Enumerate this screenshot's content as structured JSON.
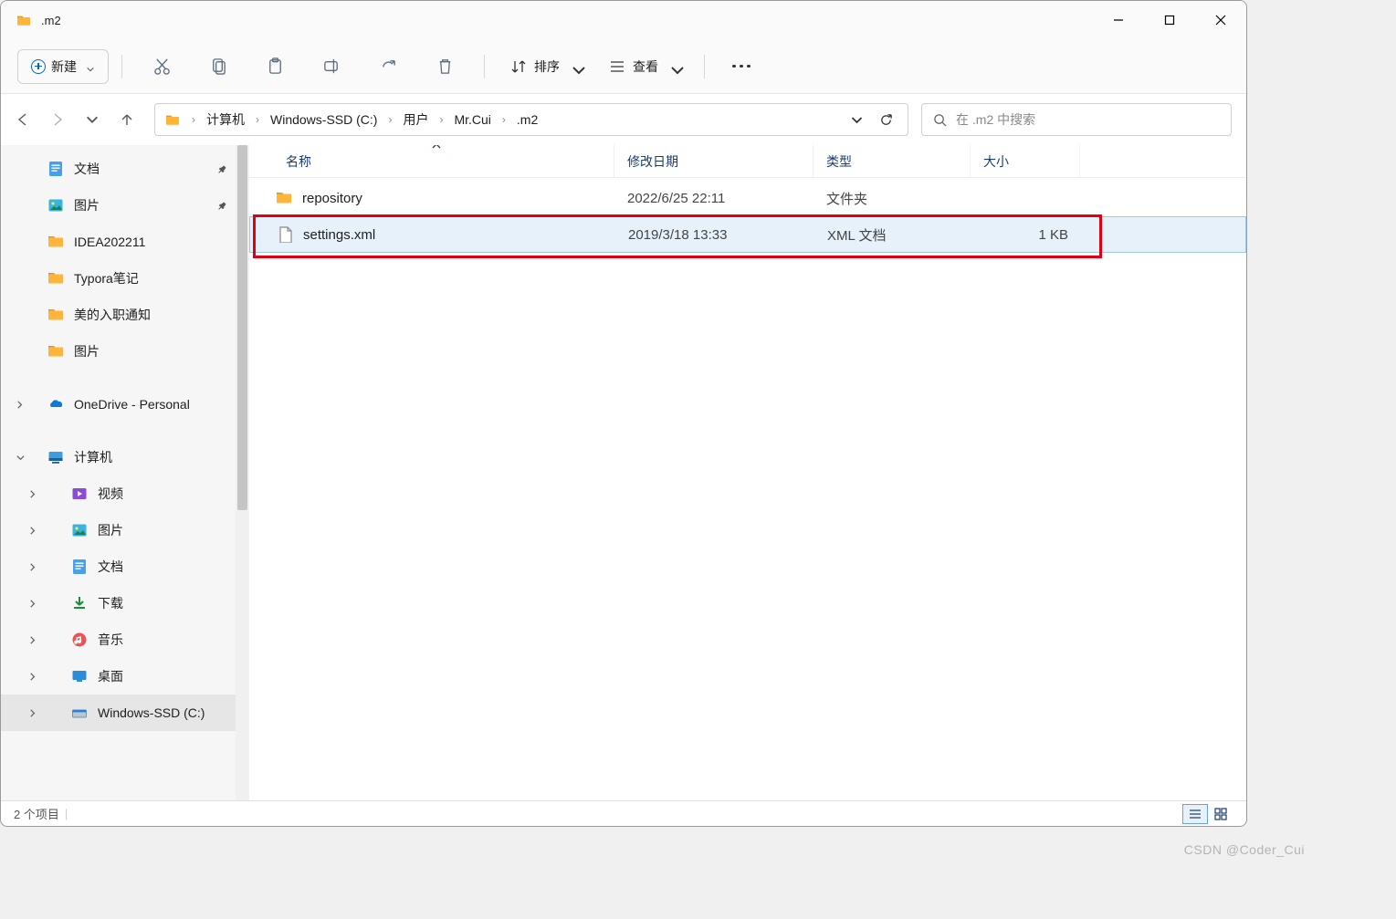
{
  "title": ".m2",
  "toolbar": {
    "new_label": "新建",
    "sort_label": "排序",
    "view_label": "查看"
  },
  "breadcrumbs": [
    "计算机",
    "Windows-SSD (C:)",
    "用户",
    "Mr.Cui",
    ".m2"
  ],
  "search_placeholder": "在 .m2 中搜索",
  "columns": {
    "name": "名称",
    "date": "修改日期",
    "type": "类型",
    "size": "大小"
  },
  "files": [
    {
      "icon": "folder",
      "name": "repository",
      "date": "2022/6/25 22:11",
      "type": "文件夹",
      "size": "",
      "highlight": false
    },
    {
      "icon": "file",
      "name": "settings.xml",
      "date": "2019/3/18 13:33",
      "type": "XML 文档",
      "size": "1 KB",
      "highlight": true
    }
  ],
  "sidebar": {
    "quick": [
      {
        "icon": "doc",
        "label": "文档",
        "pin": true
      },
      {
        "icon": "img",
        "label": "图片",
        "pin": true
      },
      {
        "icon": "folder",
        "label": "IDEA202211",
        "pin": false
      },
      {
        "icon": "folder",
        "label": "Typora笔记",
        "pin": false
      },
      {
        "icon": "folder",
        "label": "美的入职通知",
        "pin": false
      },
      {
        "icon": "folder",
        "label": "图片",
        "pin": false
      }
    ],
    "onedrive": "OneDrive - Personal",
    "computer": "计算机",
    "computer_items": [
      {
        "icon": "video",
        "label": "视频"
      },
      {
        "icon": "img",
        "label": "图片"
      },
      {
        "icon": "doc",
        "label": "文档"
      },
      {
        "icon": "down",
        "label": "下载"
      },
      {
        "icon": "music",
        "label": "音乐"
      },
      {
        "icon": "desk",
        "label": "桌面"
      },
      {
        "icon": "drive",
        "label": "Windows-SSD (C:)"
      }
    ]
  },
  "status": "2 个项目",
  "watermark": "CSDN @Coder_Cui"
}
